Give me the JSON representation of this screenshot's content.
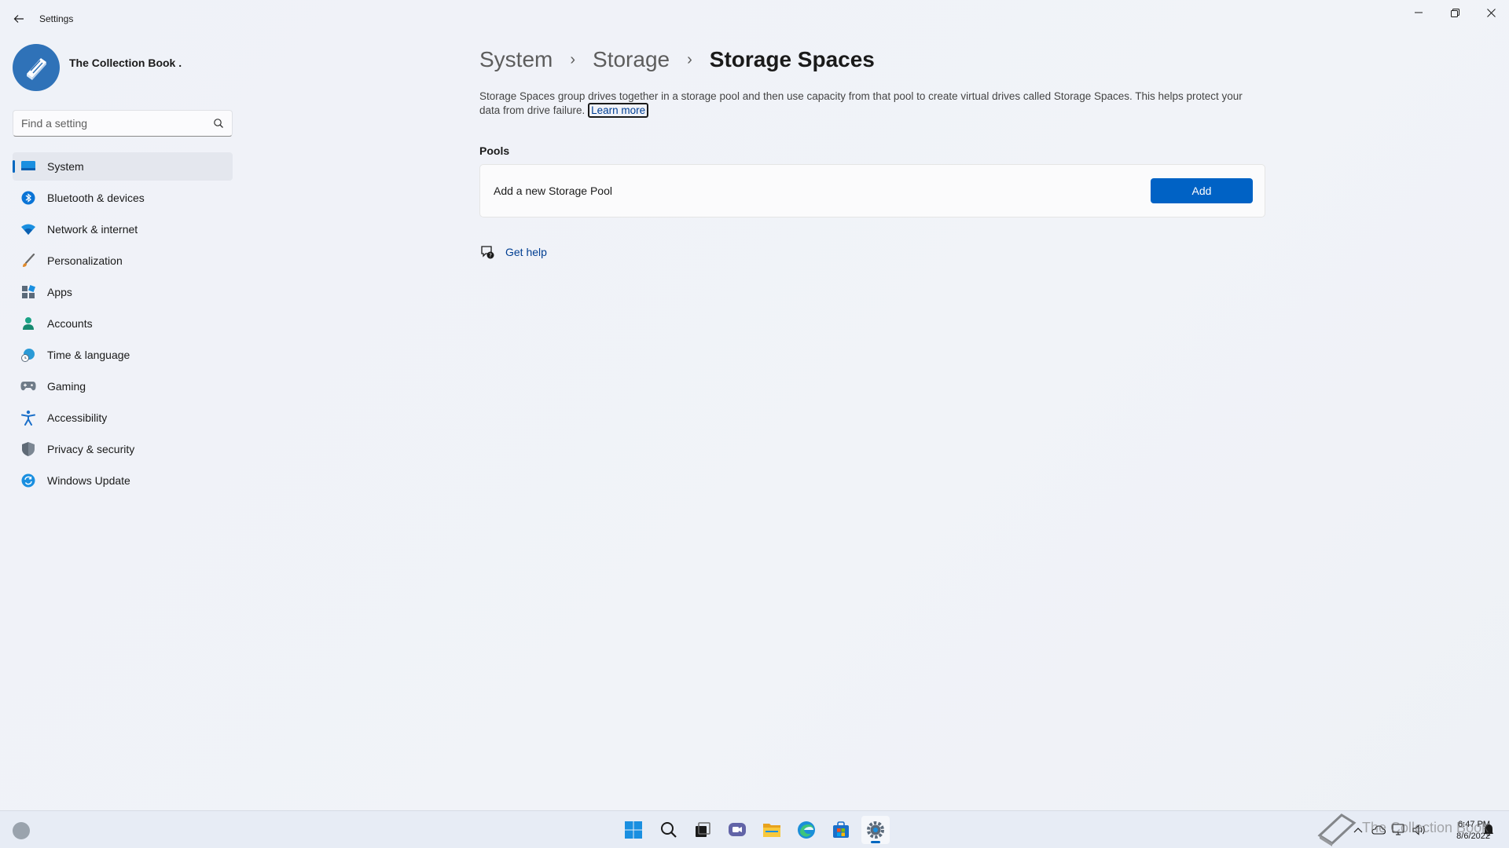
{
  "window": {
    "app_title": "Settings",
    "back_icon": "arrow-left-icon",
    "controls": {
      "minimize": "minimize-icon",
      "maximize": "restore-icon",
      "close": "close-icon"
    }
  },
  "profile": {
    "name": "The Collection Book .",
    "avatar_icon": "book-icon"
  },
  "search": {
    "placeholder": "Find a setting"
  },
  "sidebar": {
    "items": [
      {
        "label": "System",
        "icon": "monitor-icon",
        "active": true
      },
      {
        "label": "Bluetooth & devices",
        "icon": "bluetooth-icon"
      },
      {
        "label": "Network & internet",
        "icon": "wifi-icon"
      },
      {
        "label": "Personalization",
        "icon": "brush-icon"
      },
      {
        "label": "Apps",
        "icon": "apps-icon"
      },
      {
        "label": "Accounts",
        "icon": "person-icon"
      },
      {
        "label": "Time & language",
        "icon": "globe-clock-icon"
      },
      {
        "label": "Gaming",
        "icon": "gamepad-icon"
      },
      {
        "label": "Accessibility",
        "icon": "accessibility-icon"
      },
      {
        "label": "Privacy & security",
        "icon": "shield-icon"
      },
      {
        "label": "Windows Update",
        "icon": "sync-icon"
      }
    ]
  },
  "breadcrumb": {
    "items": [
      "System",
      "Storage"
    ],
    "current": "Storage Spaces",
    "separator": "›"
  },
  "main": {
    "description": "Storage Spaces group drives together in a storage pool and then use capacity from that pool to create virtual drives called Storage Spaces. This helps protect your data from drive failure.",
    "learn_more": "Learn more",
    "pools_title": "Pools",
    "pool_card_label": "Add a new Storage Pool",
    "add_button": "Add",
    "help_link": "Get help"
  },
  "taskbar": {
    "apps": [
      "start-icon",
      "search-icon",
      "task-view-icon",
      "chat-icon",
      "file-explorer-icon",
      "edge-icon",
      "store-icon",
      "settings-icon"
    ],
    "tray": [
      "chevron-up-icon",
      "cloud-icon",
      "display-icon",
      "speaker-icon",
      "notification-icon"
    ],
    "time": "6:47 PM",
    "date": "8/6/2022",
    "watermark": "The Collection Book"
  },
  "colors": {
    "accent": "#0067c0",
    "button": "#0062c5",
    "link": "#003e92"
  }
}
